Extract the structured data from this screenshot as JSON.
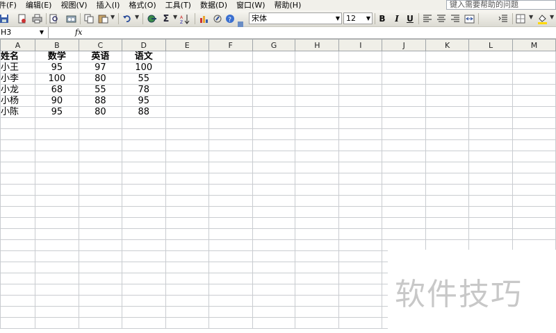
{
  "menu": [
    "件(F)",
    "编辑(E)",
    "视图(V)",
    "插入(I)",
    "格式(O)",
    "工具(T)",
    "数据(D)",
    "窗口(W)",
    "帮助(H)"
  ],
  "help_search_placeholder": "键入需要帮助的问题",
  "toolbar": {
    "sum_symbol": "Σ",
    "font_name": "宋体",
    "font_size": "12",
    "bold": "B",
    "italic": "I",
    "underline": "U"
  },
  "formula_bar": {
    "name_box": "H3",
    "fx": "fx"
  },
  "columns": [
    "A",
    "B",
    "C",
    "D",
    "E",
    "F",
    "G",
    "H",
    "I",
    "J",
    "K",
    "L",
    "M"
  ],
  "table": {
    "headers": [
      "姓名",
      "数学",
      "英语",
      "语文"
    ],
    "rows": [
      [
        "小王",
        "95",
        "97",
        "100"
      ],
      [
        "小李",
        "100",
        "80",
        "55"
      ],
      [
        "小龙",
        "68",
        "55",
        "78"
      ],
      [
        "小杨",
        "90",
        "88",
        "95"
      ],
      [
        "小陈",
        "95",
        "80",
        "88"
      ]
    ]
  },
  "watermark": "软件技巧",
  "colors": {
    "menubar": "#f1f0ea",
    "grid": "#c9ccd0",
    "header_bg": "#f0efe8"
  }
}
